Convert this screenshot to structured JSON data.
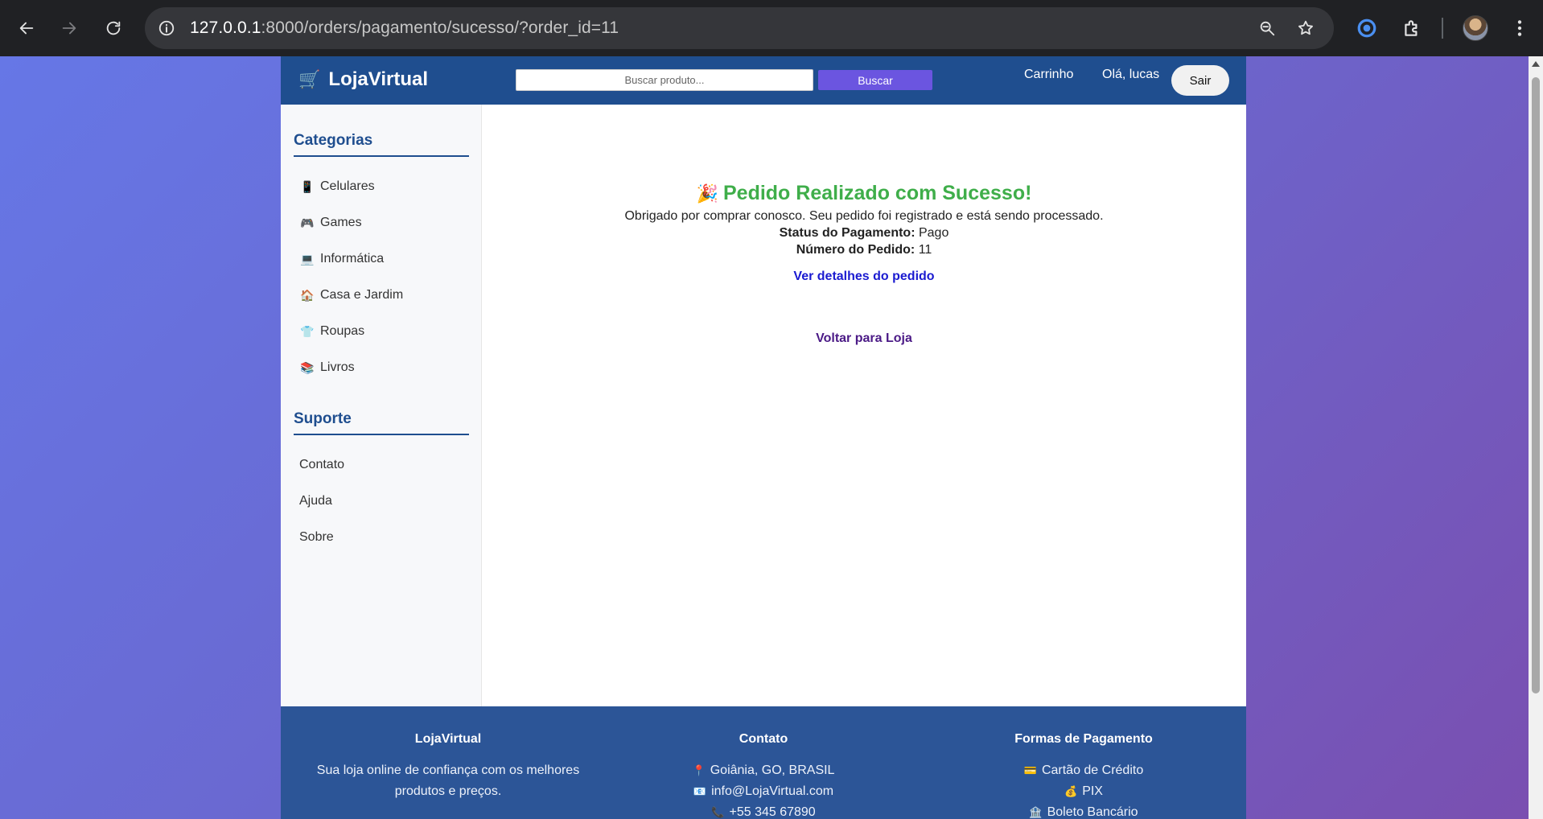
{
  "browser": {
    "url_host": "127.0.0.1",
    "url_rest": ":8000/orders/pagamento/sucesso/?order_id=11"
  },
  "header": {
    "brand_icon": "🛒",
    "brand": "LojaVirtual",
    "search_placeholder": "Buscar produto...",
    "search_button": "Buscar",
    "cart": "Carrinho",
    "greeting": "Olá, lucas",
    "logout": "Sair"
  },
  "sidebar": {
    "categories_title": "Categorias",
    "categories": [
      {
        "icon": "📱",
        "label": "Celulares"
      },
      {
        "icon": "🎮",
        "label": "Games"
      },
      {
        "icon": "💻",
        "label": "Informática"
      },
      {
        "icon": "🏠",
        "label": "Casa e Jardim"
      },
      {
        "icon": "👕",
        "label": "Roupas"
      },
      {
        "icon": "📚",
        "label": "Livros"
      }
    ],
    "support_title": "Suporte",
    "support": [
      "Contato",
      "Ajuda",
      "Sobre"
    ]
  },
  "main": {
    "title_icon": "🎉",
    "title": "Pedido Realizado com Sucesso!",
    "message": "Obrigado por comprar conosco. Seu pedido foi registrado e está sendo processado.",
    "payment_status_label": "Status do Pagamento:",
    "payment_status_value": "Pago",
    "order_number_label": "Número do Pedido:",
    "order_number_value": "11",
    "details_link": "Ver detalhes do pedido",
    "back_link": "Voltar para Loja"
  },
  "footer": {
    "about_title": "LojaVirtual",
    "about_text": "Sua loja online de confiança com os melhores produtos e preços.",
    "contact_title": "Contato",
    "contact": [
      {
        "icon": "📍",
        "text": "Goiânia, GO, BRASIL"
      },
      {
        "icon": "📧",
        "text": "info@LojaVirtual.com"
      },
      {
        "icon": "📞",
        "text": "+55 345 67890"
      }
    ],
    "payments_title": "Formas de Pagamento",
    "payments": [
      {
        "icon": "💳",
        "text": "Cartão de Crédito"
      },
      {
        "icon": "💰",
        "text": "PIX"
      },
      {
        "icon": "🏦",
        "text": "Boleto Bancário"
      }
    ]
  }
}
